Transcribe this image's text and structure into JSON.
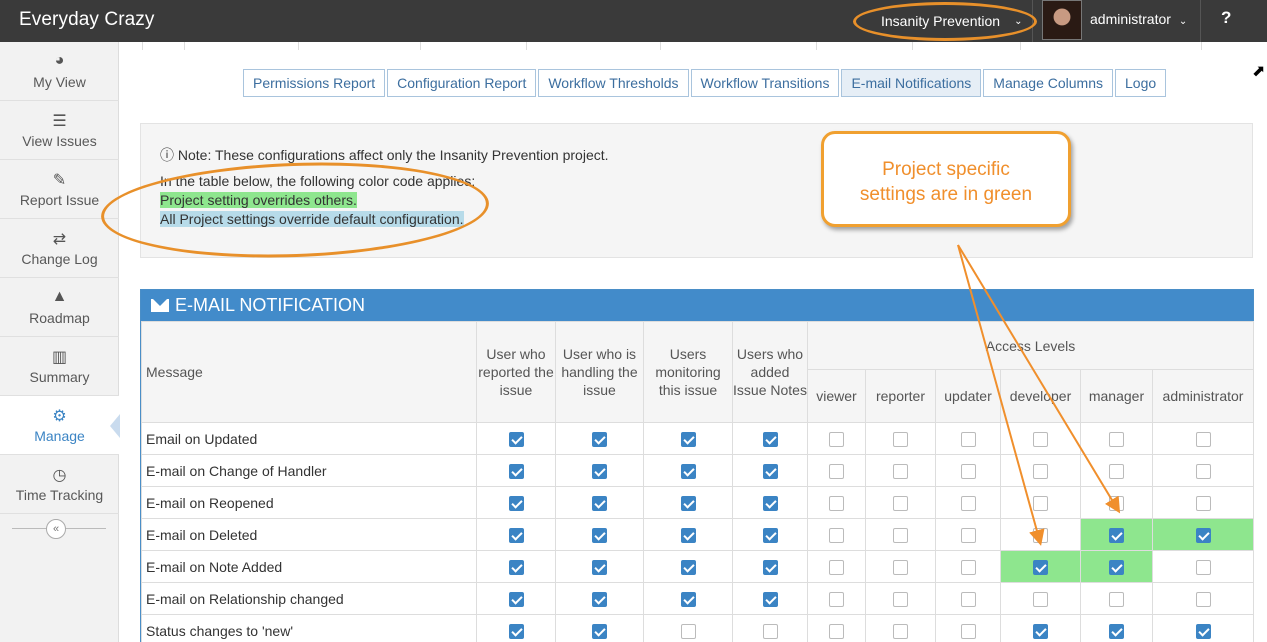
{
  "app": {
    "title": "Everyday Crazy"
  },
  "navbar": {
    "project": "Insanity Prevention",
    "user": "administrator",
    "help": "?"
  },
  "sidebar": {
    "items": [
      {
        "label": "My View",
        "icon": "dashboard-icon",
        "glyph": "◕"
      },
      {
        "label": "View Issues",
        "icon": "list-icon",
        "glyph": "☰"
      },
      {
        "label": "Report Issue",
        "icon": "edit-icon",
        "glyph": "✎"
      },
      {
        "label": "Change Log",
        "icon": "retweet-icon",
        "glyph": "⇄"
      },
      {
        "label": "Roadmap",
        "icon": "road-icon",
        "glyph": "▲"
      },
      {
        "label": "Summary",
        "icon": "bar-chart-icon",
        "glyph": "▥"
      },
      {
        "label": "Manage",
        "icon": "gears-icon",
        "glyph": "⚙"
      },
      {
        "label": "Time Tracking",
        "icon": "clock-icon",
        "glyph": "◷"
      }
    ],
    "active": "Manage",
    "collapse": "«"
  },
  "tabs": [
    "Permissions Report",
    "Configuration Report",
    "Workflow Thresholds",
    "Workflow Transitions",
    "E-mail Notifications",
    "Manage Columns",
    "Logo"
  ],
  "active_tab": "E-mail Notifications",
  "note": {
    "title": "Note: These configurations affect only the Insanity Prevention project.",
    "line1": "In the table below, the following color code applies:",
    "line2": "Project setting overrides others.",
    "line3": "All Project settings override default configuration."
  },
  "callout": {
    "line1": "Project specific",
    "line2": "settings are in green"
  },
  "colors": {
    "accent": "#428bca",
    "project_green": "#8ee68e",
    "all_project_blue": "#b7dbe9",
    "annotation_orange": "#f08f2c"
  },
  "widget": {
    "title": "E-MAIL NOTIFICATION"
  },
  "table": {
    "col_message": "Message",
    "col_reporter": "User who reported the issue",
    "col_handler": "User who is handling the issue",
    "col_monitor": "Users monitoring this issue",
    "col_notes": "Users who added Issue Notes",
    "access_levels": "Access Levels",
    "levels": [
      "viewer",
      "reporter",
      "updater",
      "developer",
      "manager",
      "administrator"
    ],
    "rows": [
      {
        "label": "Email on Updated",
        "checks": [
          1,
          1,
          1,
          1,
          0,
          0,
          0,
          0,
          0,
          0
        ],
        "green": []
      },
      {
        "label": "E-mail on Change of Handler",
        "checks": [
          1,
          1,
          1,
          1,
          0,
          0,
          0,
          0,
          0,
          0
        ],
        "green": []
      },
      {
        "label": "E-mail on Reopened",
        "checks": [
          1,
          1,
          1,
          1,
          0,
          0,
          0,
          0,
          0,
          0
        ],
        "green": []
      },
      {
        "label": "E-mail on Deleted",
        "checks": [
          1,
          1,
          1,
          1,
          0,
          0,
          0,
          0,
          1,
          1
        ],
        "green": [
          8,
          9
        ]
      },
      {
        "label": "E-mail on Note Added",
        "checks": [
          1,
          1,
          1,
          1,
          0,
          0,
          0,
          1,
          1,
          0
        ],
        "green": [
          7,
          8
        ]
      },
      {
        "label": "E-mail on Relationship changed",
        "checks": [
          1,
          1,
          1,
          1,
          0,
          0,
          0,
          0,
          0,
          0
        ],
        "green": []
      },
      {
        "label": "Status changes to 'new'",
        "checks": [
          1,
          1,
          0,
          0,
          0,
          0,
          0,
          1,
          1,
          1
        ],
        "green": []
      }
    ]
  }
}
